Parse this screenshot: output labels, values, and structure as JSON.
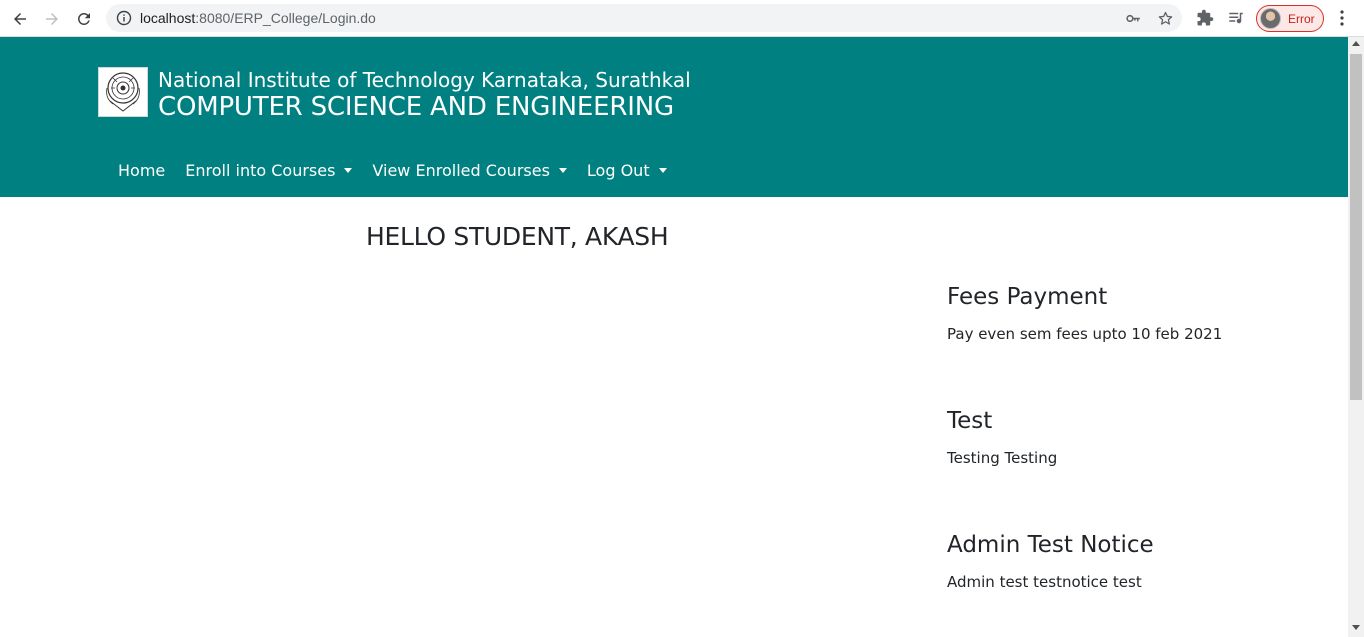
{
  "browser": {
    "url_host": "localhost",
    "url_path": ":8080/ERP_College/Login.do",
    "profile_status": "Error",
    "icons": {
      "back": "back-arrow-icon",
      "forward": "forward-arrow-icon",
      "reload": "reload-icon",
      "site_info": "info-icon",
      "password": "key-icon",
      "bookmark": "star-icon",
      "extensions": "puzzle-icon",
      "media": "playlist-icon",
      "menu": "kebab-menu-icon"
    },
    "colors": {
      "error": "#d93025"
    }
  },
  "header": {
    "institute": "National Institute of Technology Karnataka, Surathkal",
    "department": "COMPUTER SCIENCE AND ENGINEERING",
    "background": "#008080",
    "nav": {
      "home": "Home",
      "enroll": "Enroll into Courses",
      "view_enrolled": "View Enrolled Courses",
      "logout": "Log Out"
    }
  },
  "main": {
    "greeting": "HELLO STUDENT, AKASH"
  },
  "notices": [
    {
      "title": "Fees Payment",
      "body": "Pay even sem fees upto 10 feb 2021"
    },
    {
      "title": "Test",
      "body": "Testing Testing"
    },
    {
      "title": "Admin Test Notice",
      "body": "Admin test testnotice test"
    }
  ]
}
